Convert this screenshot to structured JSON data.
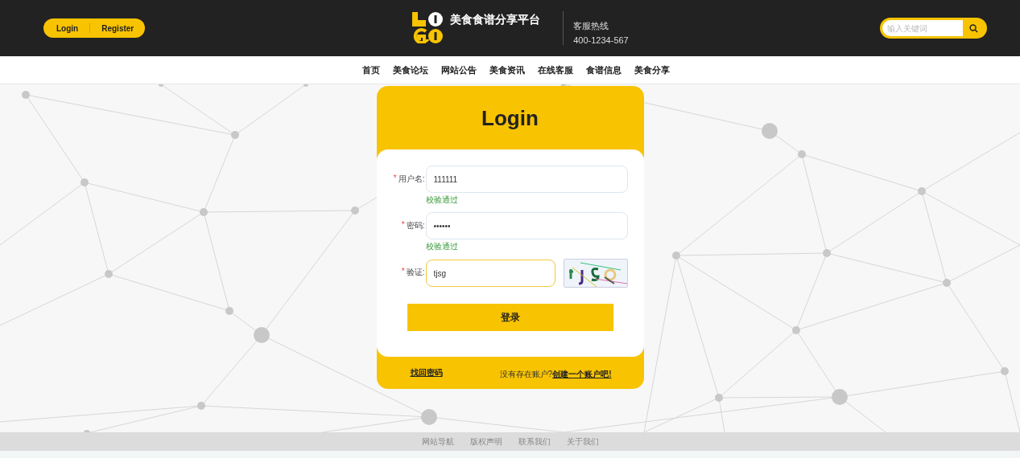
{
  "header": {
    "auth_links": [
      {
        "label": "Login"
      },
      {
        "label": "Register"
      }
    ],
    "site_title": "美食食谱分享平台",
    "hotline": {
      "label": "客服热线",
      "number": "400-1234-567"
    },
    "search": {
      "placeholder": "输入关键词"
    }
  },
  "nav": {
    "items": [
      {
        "label": "首页"
      },
      {
        "label": "美食论坛"
      },
      {
        "label": "网站公告"
      },
      {
        "label": "美食资讯"
      },
      {
        "label": "在线客服"
      },
      {
        "label": "食谱信息"
      },
      {
        "label": "美食分享"
      }
    ]
  },
  "login": {
    "title": "Login",
    "fields": [
      {
        "kind": "text",
        "label": "用户名:",
        "required_mark": "*",
        "value": "111111",
        "focused": false,
        "validation": "校验通过"
      },
      {
        "kind": "text",
        "label": "密码:",
        "required_mark": "*",
        "value": "••••••",
        "focused": false,
        "validation": "校验通过"
      },
      {
        "kind": "captcha",
        "label": "验证:",
        "required_mark": "*",
        "value": "tjsg",
        "focused": true
      }
    ],
    "submit": "登录",
    "forgot_link": "找回密码",
    "signup_prompt": "没有存在账户?",
    "signup_link": "创建一个账户吧!"
  },
  "footer": {
    "links": [
      {
        "label": "网站导航"
      },
      {
        "label": "版权声明"
      },
      {
        "label": "联系我们"
      },
      {
        "label": "关于我们"
      }
    ]
  }
}
